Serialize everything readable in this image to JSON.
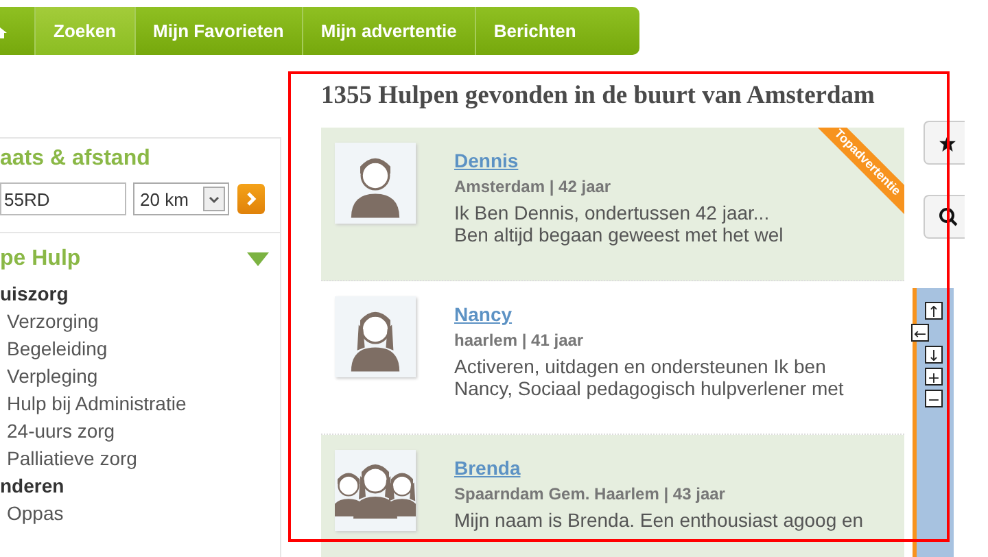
{
  "nav": {
    "items": [
      {
        "label": "Zoeken",
        "selected": true
      },
      {
        "label": "Mijn Favorieten",
        "selected": false
      },
      {
        "label": "Mijn advertentie",
        "selected": false
      },
      {
        "label": "Berichten",
        "selected": false
      }
    ]
  },
  "sidebar": {
    "location": {
      "heading": "aats & afstand",
      "postcode": "55RD",
      "distance": "20 km"
    },
    "category": {
      "heading": "pe Hulp",
      "expanded": true,
      "groups": [
        {
          "label": "uiszorg",
          "children": [
            "Verzorging",
            "Begeleiding",
            "Verpleging",
            "Hulp bij Administratie",
            "24-uurs zorg",
            "Palliatieve zorg"
          ]
        },
        {
          "label": "nderen",
          "children": [
            "Oppas"
          ]
        }
      ]
    }
  },
  "results": {
    "title": "1355 Hulpen gevonden in de buurt van Amsterdam",
    "cards": [
      {
        "name": "Dennis",
        "meta": "Amsterdam | 42 jaar",
        "description": [
          "Ik Ben Dennis, ondertussen 42 jaar...",
          "Ben altijd begaan geweest met het wel"
        ],
        "kind": "man",
        "highlighted": true,
        "badge": "Topadvertentie"
      },
      {
        "name": "Nancy",
        "meta": "haarlem | 41 jaar",
        "description": [
          "Activeren, uitdagen en ondersteunen Ik ben",
          "Nancy, Sociaal pedagogisch hulpverlener met"
        ],
        "kind": "woman",
        "highlighted": false
      },
      {
        "name": "Brenda",
        "meta": "Spaarndam Gem. Haarlem | 43 jaar",
        "description": [
          "Mijn naam is Brenda. Een enthousiast agoog en"
        ],
        "kind": "group",
        "highlighted": true
      }
    ]
  },
  "map": {
    "controls": [
      "↑",
      "←",
      "↓",
      "+",
      "−"
    ]
  }
}
